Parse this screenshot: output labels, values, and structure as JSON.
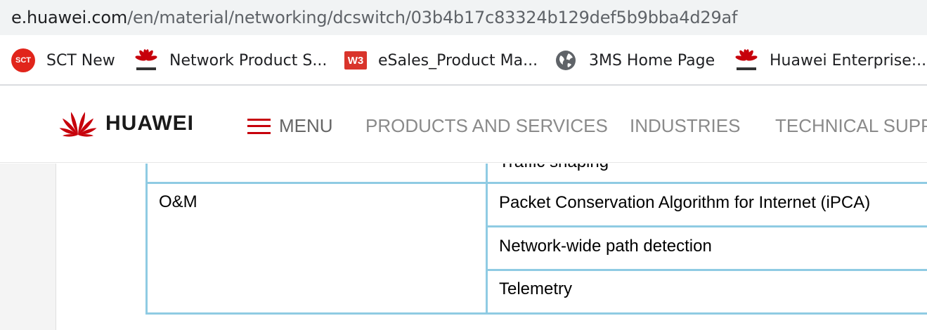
{
  "browser": {
    "url_domain": "e.huawei.com",
    "url_path": "/en/material/networking/dcswitch/03b4b17c83324b129def5b9bba4d29af"
  },
  "bookmarks": [
    {
      "label": "SCT New",
      "icon": "sct-icon"
    },
    {
      "label": "Network Product S...",
      "icon": "huawei-icon"
    },
    {
      "label": "eSales_Product Ma...",
      "icon": "w3-icon"
    },
    {
      "label": "3MS Home Page",
      "icon": "globe-icon"
    },
    {
      "label": "Huawei Enterprise:...",
      "icon": "huawei-icon"
    }
  ],
  "bookmark_icon_text": {
    "sct": "SCT",
    "w3": "W3"
  },
  "header": {
    "logo_text": "HUAWEI",
    "menu_label": "MENU",
    "nav": [
      "PRODUCTS AND SERVICES",
      "INDUSTRIES",
      "TECHNICAL SUPPO"
    ]
  },
  "table": {
    "partial_top_row": "Traffic shaping",
    "category": "O&M",
    "features": [
      "Packet Conservation Algorithm for Internet (iPCA)",
      "Network-wide path detection",
      "Telemetry"
    ]
  },
  "colors": {
    "brand_red": "#c7000b",
    "table_border": "#8fcbe3",
    "address_bar_bg": "#f1f3f4"
  }
}
